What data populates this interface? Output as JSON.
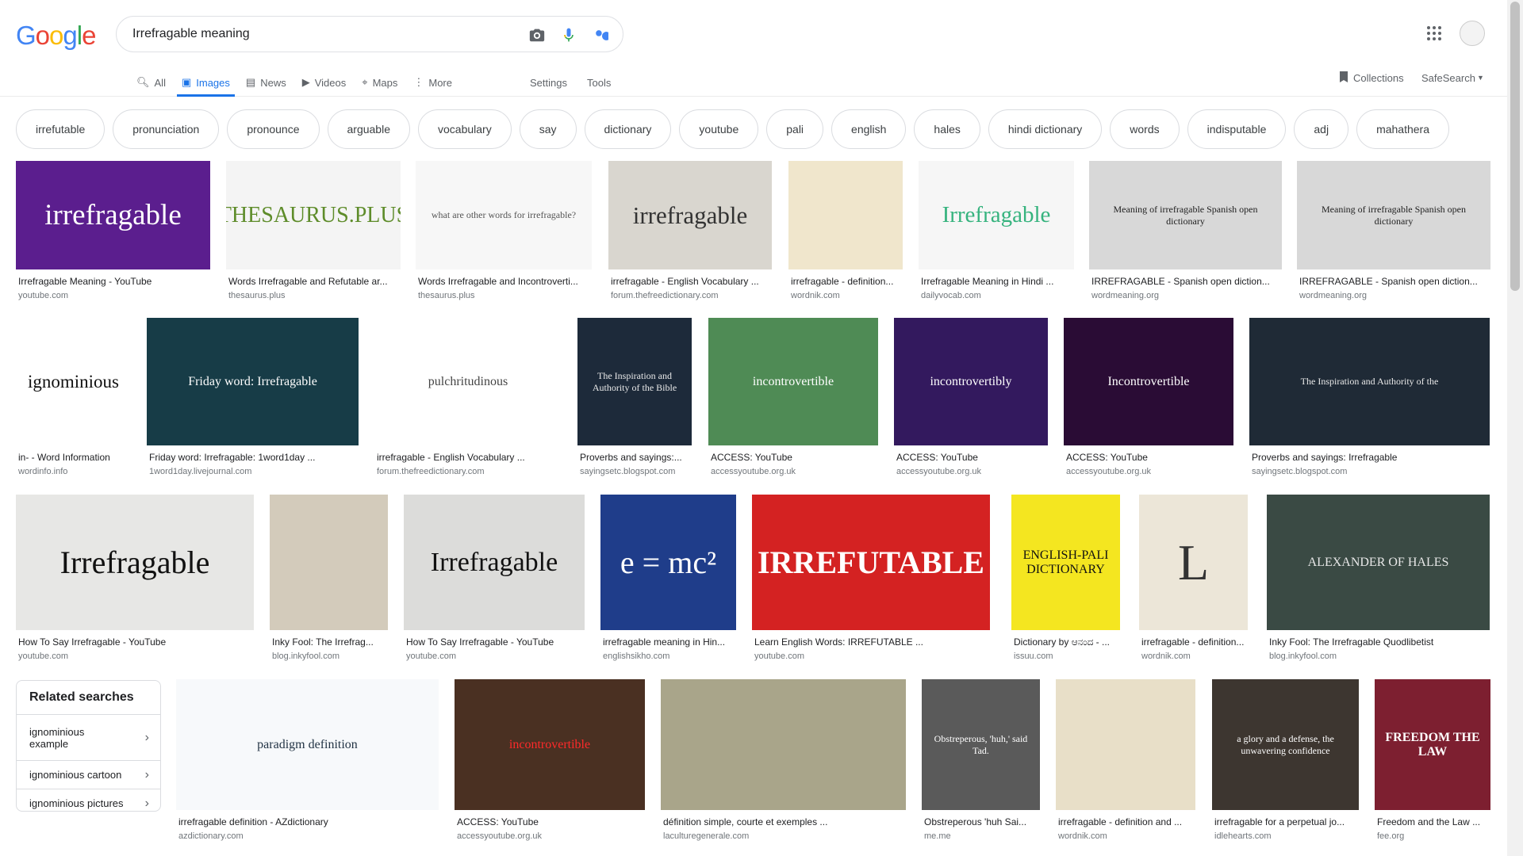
{
  "logo": {
    "letters": [
      "G",
      "o",
      "o",
      "g",
      "l",
      "e"
    ],
    "colors": [
      "#4285F4",
      "#EA4335",
      "#FBBC05",
      "#4285F4",
      "#34A853",
      "#EA4335"
    ]
  },
  "search": {
    "value": "Irrefragable meaning"
  },
  "tabs": [
    {
      "label": "All",
      "icon": "search-icon"
    },
    {
      "label": "Images",
      "icon": "image-icon",
      "active": true
    },
    {
      "label": "News",
      "icon": "news-icon"
    },
    {
      "label": "Videos",
      "icon": "video-icon"
    },
    {
      "label": "Maps",
      "icon": "map-icon"
    },
    {
      "label": "More",
      "icon": "more-vert-icon"
    }
  ],
  "settings_label": "Settings",
  "tools_label": "Tools",
  "collections_label": "Collections",
  "safesearch_label": "SafeSearch",
  "chips": [
    "irrefutable",
    "pronunciation",
    "pronounce",
    "arguable",
    "vocabulary",
    "say",
    "dictionary",
    "youtube",
    "pali",
    "english",
    "hales",
    "hindi dictionary",
    "words",
    "indisputable",
    "adj",
    "mahathera"
  ],
  "results": [
    {
      "title": "Irrefragable Meaning - YouTube",
      "source": "youtube.com",
      "thumb_text": "irrefragable",
      "bg": "#5b1e8e",
      "fg": "#ffffff"
    },
    {
      "title": "Words Irrefragable and Refutable ar...",
      "source": "thesaurus.plus",
      "thumb_text": "THESAURUS.PLUS",
      "bg": "#f4f4f4",
      "fg": "#5e8c2a"
    },
    {
      "title": "Words Irrefragable and Incontroverti...",
      "source": "thesaurus.plus",
      "thumb_text": "what are other words for irrefragable?",
      "bg": "#f7f7f7",
      "fg": "#555555"
    },
    {
      "title": "irrefragable - English Vocabulary ...",
      "source": "forum.thefreedictionary.com",
      "thumb_text": "irrefragable",
      "bg": "#d9d6cf",
      "fg": "#333333"
    },
    {
      "title": "irrefragable - definition...",
      "source": "wordnik.com",
      "thumb_text": "",
      "bg": "#f0e6cc",
      "fg": "#333333"
    },
    {
      "title": "Irrefragable Meaning in Hindi ...",
      "source": "dailyvocab.com",
      "thumb_text": "Irrefragable",
      "bg": "#f6f6f6",
      "fg": "#36b37e"
    },
    {
      "title": "IRREFRAGABLE - Spanish open diction...",
      "source": "wordmeaning.org",
      "thumb_text": "Meaning of irrefragable Spanish open dictionary",
      "bg": "#d8d8d8",
      "fg": "#222222"
    },
    {
      "title": "IRREFRAGABLE - Spanish open diction...",
      "source": "wordmeaning.org",
      "thumb_text": "Meaning of irrefragable Spanish open dictionary",
      "bg": "#d8d8d8",
      "fg": "#222222"
    },
    {
      "title": "in- - Word Information",
      "source": "wordinfo.info",
      "thumb_text": "ignominious",
      "bg": "#ffffff",
      "fg": "#111111"
    },
    {
      "title": "Friday word: Irrefragable: 1word1day ...",
      "source": "1word1day.livejournal.com",
      "thumb_text": "Friday word: Irrefragable",
      "bg": "#173c47",
      "fg": "#ffffff"
    },
    {
      "title": "irrefragable - English Vocabulary ...",
      "source": "forum.thefreedictionary.com",
      "thumb_text": "pulchritudinous",
      "bg": "#ffffff",
      "fg": "#444444"
    },
    {
      "title": "Proverbs and sayings:...",
      "source": "sayingsetc.blogspot.com",
      "thumb_text": "The Inspiration and Authority of the Bible",
      "bg": "#1d2a3a",
      "fg": "#e8e8e8"
    },
    {
      "title": "ACCESS: YouTube",
      "source": "accessyoutube.org.uk",
      "thumb_text": "incontrovertible",
      "bg": "#4f8b55",
      "fg": "#ffffff"
    },
    {
      "title": "ACCESS: YouTube",
      "source": "accessyoutube.org.uk",
      "thumb_text": "incontrovertibly",
      "bg": "#33195e",
      "fg": "#ffffff"
    },
    {
      "title": "ACCESS: YouTube",
      "source": "accessyoutube.org.uk",
      "thumb_text": "Incontrovertible",
      "bg": "#2a0c35",
      "fg": "#ffffff"
    },
    {
      "title": "Proverbs and sayings: Irrefragable",
      "source": "sayingsetc.blogspot.com",
      "thumb_text": "The Inspiration and Authority of the",
      "bg": "#1f2a36",
      "fg": "#e8e8e8"
    },
    {
      "title": "How To Say Irrefragable - YouTube",
      "source": "youtube.com",
      "thumb_text": "Irrefragable",
      "bg": "#e7e7e5",
      "fg": "#111111"
    },
    {
      "title": "Inky Fool: The Irrefrag...",
      "source": "blog.inkyfool.com",
      "thumb_text": "",
      "bg": "#d3cbbb",
      "fg": "#333333"
    },
    {
      "title": "How To Say Irrefragable - YouTube",
      "source": "youtube.com",
      "thumb_text": "Irrefragable",
      "bg": "#dcdcda",
      "fg": "#111111"
    },
    {
      "title": "irrefragable meaning in Hin...",
      "source": "englishsikho.com",
      "thumb_text": "e = mc²",
      "bg": "#1f3d8a",
      "fg": "#ffffff"
    },
    {
      "title": "Learn English Words: IRREFUTABLE ...",
      "source": "youtube.com",
      "thumb_text": "IRREFUTABLE",
      "bg": "#d42222",
      "fg": "#ffffff"
    },
    {
      "title": "Dictionary by ಆನಂದ - ...",
      "source": "issuu.com",
      "thumb_text": "ENGLISH-PALI DICTIONARY",
      "bg": "#f4e620",
      "fg": "#111111"
    },
    {
      "title": "irrefragable - definition...",
      "source": "wordnik.com",
      "thumb_text": "L",
      "bg": "#ece6d8",
      "fg": "#333333"
    },
    {
      "title": "Inky Fool: The Irrefragable Quodlibetist",
      "source": "blog.inkyfool.com",
      "thumb_text": "ALEXANDER OF HALES",
      "bg": "#3a4a44",
      "fg": "#e8e8e8"
    },
    {
      "title": "irrefragable definition - AZdictionary",
      "source": "azdictionary.com",
      "thumb_text": "paradigm definition",
      "bg": "#f7f9fb",
      "fg": "#223344"
    },
    {
      "title": "ACCESS: YouTube",
      "source": "accessyoutube.org.uk",
      "thumb_text": "incontrovertible",
      "bg": "#4a3022",
      "fg": "#ff2a2a"
    },
    {
      "title": "définition simple, courte et exemples ...",
      "source": "laculturegenerale.com",
      "thumb_text": "",
      "bg": "#a9a58a",
      "fg": "#333333"
    },
    {
      "title": "Obstreperous 'huh Sai...",
      "source": "me.me",
      "thumb_text": "Obstreperous, 'huh,' said Tad.",
      "bg": "#5a5a5a",
      "fg": "#ffffff"
    },
    {
      "title": "irrefragable - definition and ...",
      "source": "wordnik.com",
      "thumb_text": "",
      "bg": "#e8dfc8",
      "fg": "#333333"
    },
    {
      "title": "irrefragable for a perpetual jo...",
      "source": "idlehearts.com",
      "thumb_text": "a glory and a defense, the unwavering confidence",
      "bg": "#3d3630",
      "fg": "#ffffff"
    },
    {
      "title": "Freedom and the Law ...",
      "source": "fee.org",
      "thumb_text": "FREEDOM THE LAW",
      "bg": "#7d1f30",
      "fg": "#ffffff"
    }
  ],
  "related": {
    "title": "Related searches",
    "items": [
      "ignominious example",
      "ignominious cartoon",
      "ignominious pictures"
    ]
  }
}
